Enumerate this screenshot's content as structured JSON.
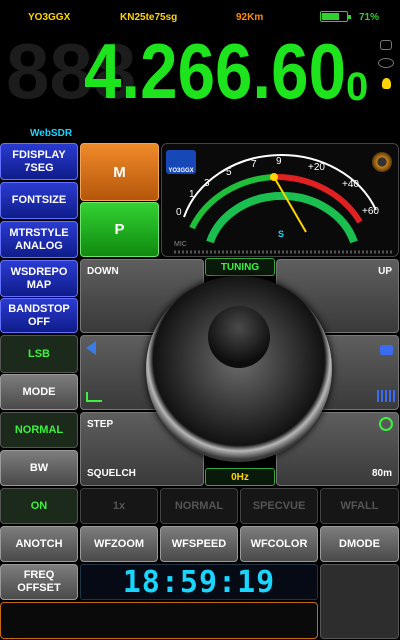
{
  "status": {
    "callsign": "YO3GGX",
    "locator": "KN25te75sg",
    "distance": "92Km",
    "battery": "71%",
    "battery_level": 0.71
  },
  "display": {
    "ghost": "888",
    "frequency": "4.266.60",
    "subdigit": "0",
    "color": "#1ee41e"
  },
  "webSDR_label": "WebSDR",
  "left_menu": [
    {
      "label": "FDISPLAY\n7SEG"
    },
    {
      "label": "FONTSIZE"
    },
    {
      "label": "MTRSTYLE\nANALOG"
    },
    {
      "label": "WSDREPO\nMAP"
    },
    {
      "label": "BANDSTOP\nOFF"
    }
  ],
  "mem_buttons": {
    "m": "M",
    "p": "P"
  },
  "meter": {
    "logo": "YO3GGX",
    "scale": [
      "0",
      "1",
      "3",
      "5",
      "7",
      "9",
      "+20",
      "+40",
      "+60"
    ],
    "s_label": "S",
    "mic_label": "MIC",
    "needle": "9"
  },
  "tuning": {
    "down": "DOWN",
    "up": "UP",
    "tuning": "TUNING",
    "step": "STEP",
    "squelch": "SQUELCH",
    "band": "80m",
    "hz": "0Hz"
  },
  "left_controls": {
    "lsb": "LSB",
    "mode": "MODE",
    "normal": "NORMAL",
    "bw": "BW"
  },
  "row1": {
    "on": "ON",
    "x1": "1x",
    "normal": "NORMAL",
    "specvue": "SPECVUE",
    "wfall": "WFALL"
  },
  "row2": {
    "anotch": "ANOTCH",
    "wfzoom": "WFZOOM",
    "wfspeed": "WFSPEED",
    "wfcolor": "WFCOLOR",
    "dmode": "DMODE"
  },
  "bottom": {
    "freq_offset": "FREQ\nOFFSET",
    "clock": "18:59:19"
  },
  "colors": {
    "green": "#1ee41e",
    "cyan": "#19d6ff",
    "orange": "#e47a1a",
    "yellow": "#ffd400"
  }
}
